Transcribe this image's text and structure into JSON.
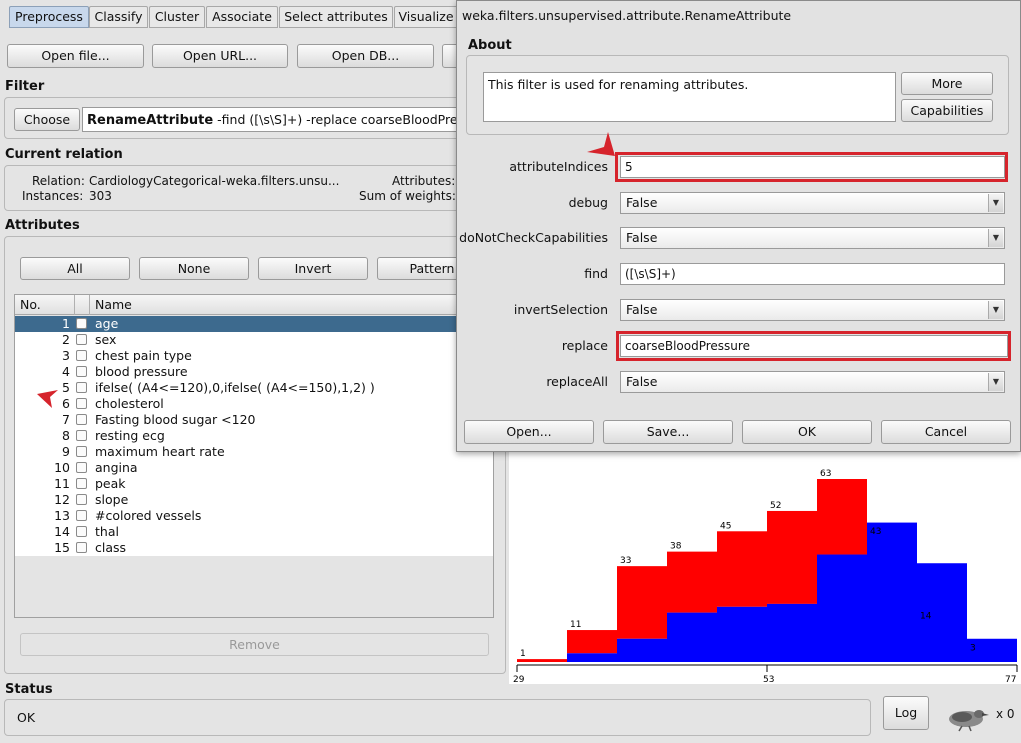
{
  "tabs": [
    "Preprocess",
    "Classify",
    "Cluster",
    "Associate",
    "Select attributes",
    "Visualize"
  ],
  "toolbar": {
    "open_file": "Open file...",
    "open_url": "Open URL...",
    "open_db": "Open DB..."
  },
  "filter": {
    "section": "Filter",
    "choose": "Choose",
    "name": "RenameAttribute",
    "options": " -find ([\\s\\S]+) -replace coarseBloodPressure"
  },
  "relation": {
    "section": "Current relation",
    "relation_label": "Relation:",
    "relation_value": "CardiologyCategorical-weka.filters.unsu...",
    "instances_label": "Instances:",
    "instances_value": "303",
    "attributes_label": "Attributes:",
    "sum_weights_label": "Sum of weights:"
  },
  "attributes": {
    "section": "Attributes",
    "buttons": {
      "all": "All",
      "none": "None",
      "invert": "Invert",
      "pattern": "Pattern"
    },
    "col_no": "No.",
    "col_name": "Name",
    "rows": [
      {
        "no": "1",
        "name": "age"
      },
      {
        "no": "2",
        "name": "sex"
      },
      {
        "no": "3",
        "name": "chest pain type"
      },
      {
        "no": "4",
        "name": "blood pressure"
      },
      {
        "no": "5",
        "name": "ifelse( (A4<=120),0,ifelse( (A4<=150),1,2) )"
      },
      {
        "no": "6",
        "name": "cholesterol"
      },
      {
        "no": "7",
        "name": "Fasting blood sugar <120"
      },
      {
        "no": "8",
        "name": "resting ecg"
      },
      {
        "no": "9",
        "name": "maximum heart rate"
      },
      {
        "no": "10",
        "name": "angina"
      },
      {
        "no": "11",
        "name": "peak"
      },
      {
        "no": "12",
        "name": "slope"
      },
      {
        "no": "13",
        "name": "#colored vessels"
      },
      {
        "no": "14",
        "name": "thal"
      },
      {
        "no": "15",
        "name": "class"
      }
    ],
    "selected_row": 0,
    "remove": "Remove"
  },
  "status": {
    "section": "Status",
    "text": "OK",
    "log": "Log",
    "x_count": "x 0"
  },
  "dialog": {
    "title": "weka.filters.unsupervised.attribute.RenameAttribute",
    "about_section": "About",
    "about_text": "This filter is used for renaming attributes.",
    "more": "More",
    "capabilities": "Capabilities",
    "params": {
      "attributeIndices": {
        "label": "attributeIndices",
        "value": "5"
      },
      "debug": {
        "label": "debug",
        "value": "False"
      },
      "doNotCheckCapabilities": {
        "label": "doNotCheckCapabilities",
        "value": "False"
      },
      "find": {
        "label": "find",
        "value": "([\\s\\S]+)"
      },
      "invertSelection": {
        "label": "invertSelection",
        "value": "False"
      },
      "replace": {
        "label": "replace",
        "value": "coarseBloodPressure"
      },
      "replaceAll": {
        "label": "replaceAll",
        "value": "False"
      }
    },
    "buttons": {
      "open": "Open...",
      "save": "Save...",
      "ok": "OK",
      "cancel": "Cancel"
    }
  },
  "colors": {
    "accent_selection": "#3d6a8e",
    "hist_red": "#ff0000",
    "hist_blue": "#0000ff",
    "highlight": "#d6242c"
  },
  "chart_data": {
    "type": "bar",
    "title": "",
    "xlabel": "",
    "ylabel": "",
    "xlim": [
      29,
      77
    ],
    "x_tick_labels": [
      "29",
      "53",
      "77"
    ],
    "bin_totals": [
      1,
      11,
      33,
      38,
      45,
      52,
      63,
      43,
      14,
      3
    ],
    "series": [
      {
        "values": [
          0,
          3,
          8,
          17,
          19,
          20,
          37,
          48,
          34,
          8
        ]
      },
      {
        "values": [
          1,
          8,
          25,
          21,
          26,
          32,
          26,
          18,
          6,
          2
        ]
      }
    ]
  }
}
